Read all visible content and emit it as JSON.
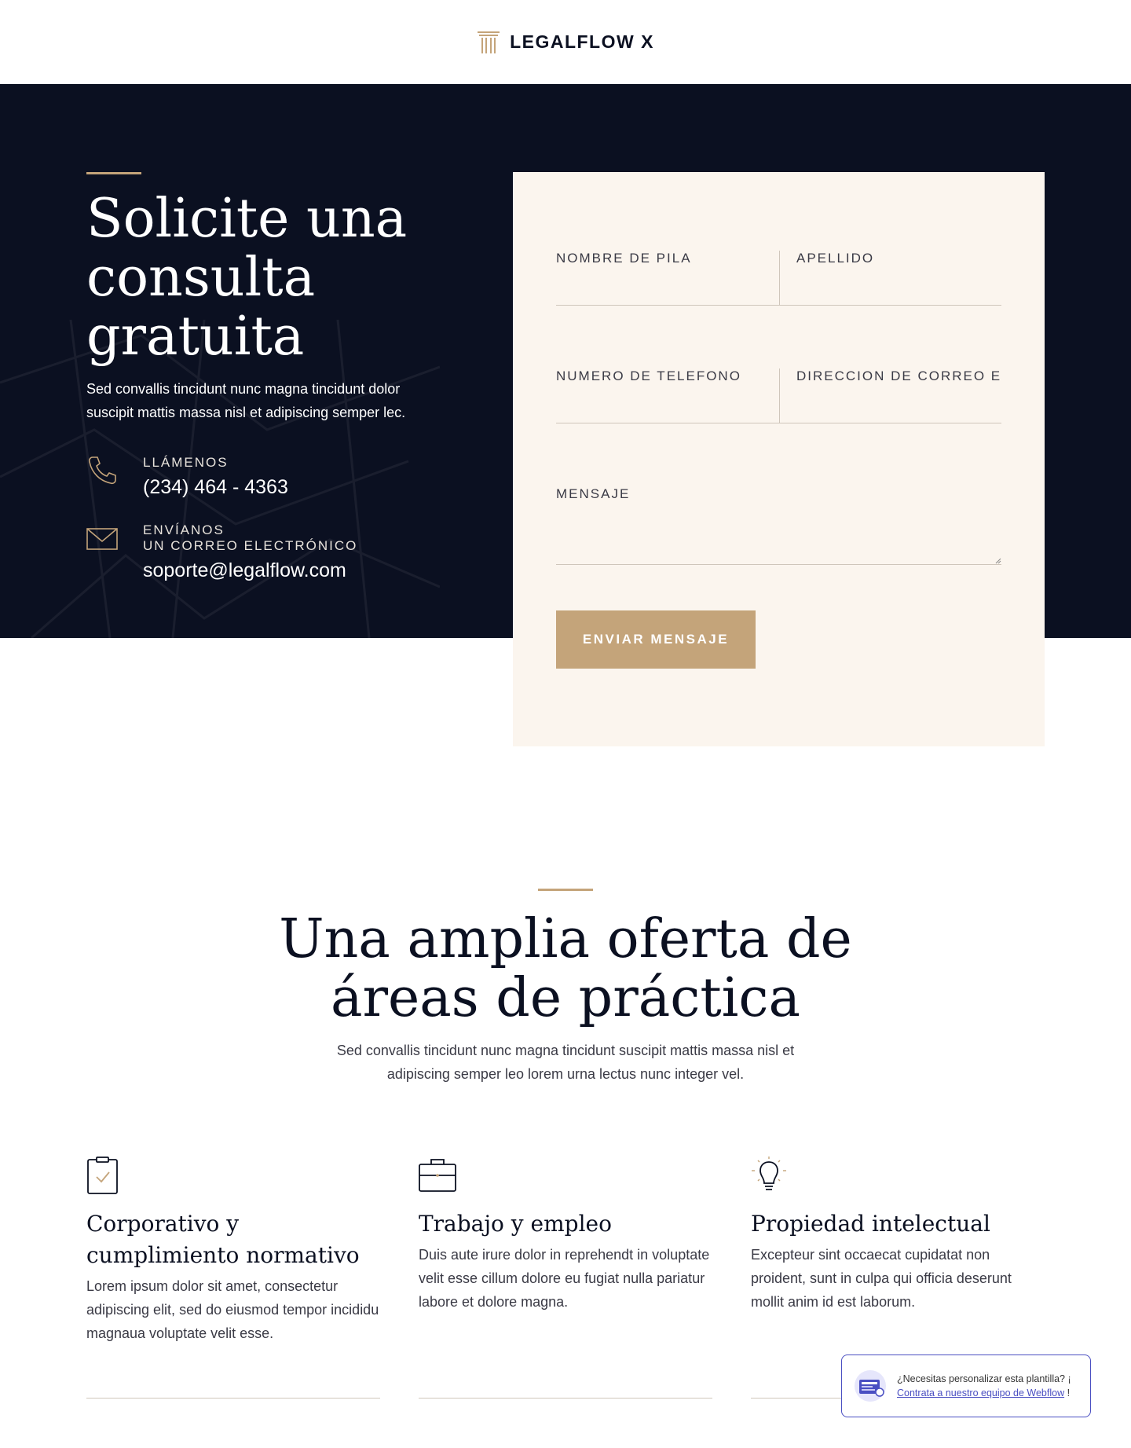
{
  "header": {
    "logo_text": "LEGALFLOW X",
    "logo_icon": "pillar-icon"
  },
  "hero": {
    "title": "Solicite una consulta gratuita",
    "description": "Sed convallis tincidunt nunc magna tincidunt dolor suscipit mattis massa nisl et adipiscing semper lec.",
    "phone": {
      "icon": "phone-icon",
      "label": "LLÁMENOS",
      "value": "(234) 464 - 4363"
    },
    "email": {
      "icon": "mail-icon",
      "label_line1": "ENVÍANOS",
      "label_line2": "UN CORREO ELECTRÓNICO",
      "value": "soporte@legalflow.com"
    }
  },
  "form": {
    "first_name_label": "NOMBRE DE PILA",
    "last_name_label": "APELLIDO",
    "phone_label": "NUMERO DE TELEFONO",
    "email_label": "DIRECCION DE CORREO EL",
    "message_label": "MENSAJE",
    "submit_label": "ENVIAR MENSAJE"
  },
  "practice": {
    "title": "Una amplia oferta de áreas de práctica",
    "description": "Sed convallis tincidunt nunc magna tincidunt suscipit mattis massa nisl et adipiscing semper leo lorem urna lectus nunc integer vel.",
    "cards": [
      {
        "icon": "clipboard-check-icon",
        "title": "Corporativo y cumplimiento normativo",
        "text": "Lorem ipsum dolor sit amet, consectetur adipiscing elit, sed do eiusmod tempor incididu magnaua voluptate velit esse."
      },
      {
        "icon": "briefcase-icon",
        "title": "Trabajo y empleo",
        "text": "Duis aute irure dolor in reprehendt in voluptate velit esse cillum dolore eu fugiat nulla pariatur labore et dolore magna."
      },
      {
        "icon": "lightbulb-icon",
        "title": "Propiedad intelectual",
        "text": "Excepteur sint occaecat cupidatat non proident, sunt in culpa qui officia deserunt mollit anim id est laborum."
      }
    ]
  },
  "popup": {
    "text_before": "¿Necesitas personalizar esta plantilla? ¡ ",
    "link_text": "Contrata a nuestro equipo de Webflow",
    "text_after": " !"
  },
  "colors": {
    "navy": "#0b1021",
    "gold": "#c4a47a",
    "cream": "#fbf5ee",
    "popup_accent": "#4a4fc2"
  }
}
